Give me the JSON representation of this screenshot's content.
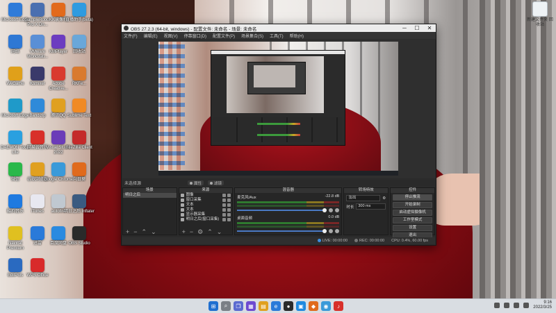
{
  "desktop": {
    "icons": [
      {
        "label": "Microsoft Edge",
        "icon": "edge-icon",
        "color": "#2f7bd9"
      },
      {
        "label": "SampleRobot Pro X Dn...",
        "icon": "samplitude-icon",
        "color": "#4a6fb0"
      },
      {
        "label": "KK录像机",
        "icon": "kk-recorder-icon",
        "color": "#e26a1c"
      },
      {
        "label": "直播助手(beta)",
        "icon": "music-icon",
        "color": "#2f9be0"
      },
      {
        "label": "网络",
        "icon": "network-icon",
        "color": "#2f78d4"
      },
      {
        "label": "VMware Workstati...",
        "icon": "vmware-icon",
        "color": "#5a8fd6"
      },
      {
        "label": "KMPlayer",
        "icon": "kmplayer-icon",
        "color": "#6c3cc0"
      },
      {
        "label": "回收站",
        "icon": "recycle-icon",
        "color": "#6aa7d9"
      },
      {
        "label": "WeGame",
        "icon": "wegame-icon",
        "color": "#e0a01a"
      },
      {
        "label": "Ksmixer",
        "icon": "mixer-icon",
        "color": "#3a3a6a"
      },
      {
        "label": "Adobe Creative...",
        "icon": "adobe-icon",
        "color": "#d93a2f"
      },
      {
        "label": "RKFe...",
        "icon": "rkfe-icon",
        "color": "#d97a2f"
      },
      {
        "label": "Microsoft Edge",
        "icon": "edge-icon",
        "color": "#1f9ac9"
      },
      {
        "label": "Bandizip",
        "icon": "bandizip-icon",
        "color": "#2f8ad9"
      },
      {
        "label": "腾讯QQ",
        "icon": "qq-icon",
        "color": "#e0a020"
      },
      {
        "label": "Sublime Text",
        "icon": "sublime-icon",
        "color": "#f08a24"
      },
      {
        "label": "DAEMON Tools Lite",
        "icon": "daemon-icon",
        "color": "#2aa0e0"
      },
      {
        "label": "网易云音乐",
        "icon": "netease-music-icon",
        "color": "#d8302a"
      },
      {
        "label": "Visual Studio 2022",
        "icon": "visual-studio-icon",
        "color": "#6b3cb8"
      },
      {
        "label": "FileZilla Client",
        "icon": "filezilla-icon",
        "color": "#c42a2a"
      },
      {
        "label": "微信",
        "icon": "wechat-icon",
        "color": "#2ab84a"
      },
      {
        "label": "谷歌浏览器",
        "icon": "chrome-icon",
        "color": "#e0a020"
      },
      {
        "label": "Google Chrome",
        "icon": "chrome-icon",
        "color": "#3a9ad9"
      },
      {
        "label": "向日葵",
        "icon": "sunflower-icon",
        "color": "#e06a1c"
      },
      {
        "label": "酷狗音乐",
        "icon": "kugou-icon",
        "color": "#1f7ae0"
      },
      {
        "label": "iTunes",
        "icon": "itunes-icon",
        "color": "#e8e8f0"
      },
      {
        "label": "autofire",
        "icon": "autofire-icon",
        "color": "#c0c8d0"
      },
      {
        "label": "明日之后 Inflater",
        "icon": "game-icon",
        "color": "#3a5a80"
      },
      {
        "label": "Navicat Premium",
        "icon": "navicat-icon",
        "color": "#e0c020"
      },
      {
        "label": "迅雷",
        "icon": "thunder-icon",
        "color": "#2a7ad9"
      },
      {
        "label": "百度网盘",
        "icon": "baidu-netdisk-icon",
        "color": "#2a8ae0"
      },
      {
        "label": "OBS Studio",
        "icon": "obs-icon",
        "color": "#2a2a2a"
      },
      {
        "label": "EditPlus",
        "icon": "editplus-icon",
        "color": "#2a6ac0"
      },
      {
        "label": "WPS Office",
        "icon": "wps-icon",
        "color": "#d82a2a"
      }
    ],
    "recycle_label": "新建文件夹\n回收站"
  },
  "obs": {
    "title": "OBS 27.2.3 (64-bit, windows) - 配置文件: 未命名 - 场景: 未命名",
    "menu": [
      "文件(F)",
      "编辑(E)",
      "视图(V)",
      "停靠窗口(D)",
      "配置文件(P)",
      "场景集合(S)",
      "工具(T)",
      "帮助(H)"
    ],
    "current_scene_label": "未选择源",
    "properties_label": "属性",
    "filters_label": "滤镜",
    "docks": {
      "scenes": {
        "title": "场景",
        "items": [
          "明日之后"
        ]
      },
      "sources": {
        "title": "来源",
        "items": [
          "图像",
          "窗口采集",
          "文本",
          "文本",
          "显示器采集",
          "明日之后(窗口采集)"
        ]
      },
      "mixer": {
        "title": "混音器",
        "tracks": [
          {
            "name": "麦克风/Aux",
            "db": "-22.8 dB"
          },
          {
            "name": "桌面音频",
            "db": "0.0 dB"
          }
        ]
      },
      "transitions": {
        "title": "转场特效",
        "type": "淡出",
        "duration_label": "时长",
        "duration": "300 ms"
      },
      "controls": {
        "title": "控件",
        "buttons": [
          "停止推流",
          "开始录制",
          "启动虚拟摄像机",
          "工作室模式",
          "设置",
          "退出"
        ]
      }
    },
    "status": {
      "live": "LIVE: 00:00:00",
      "rec": "REC: 00:00:00",
      "cpu": "CPU: 0.4%, 60.00 fps"
    }
  },
  "taskbar": {
    "time": "9:16",
    "date": "2022/3/25"
  }
}
